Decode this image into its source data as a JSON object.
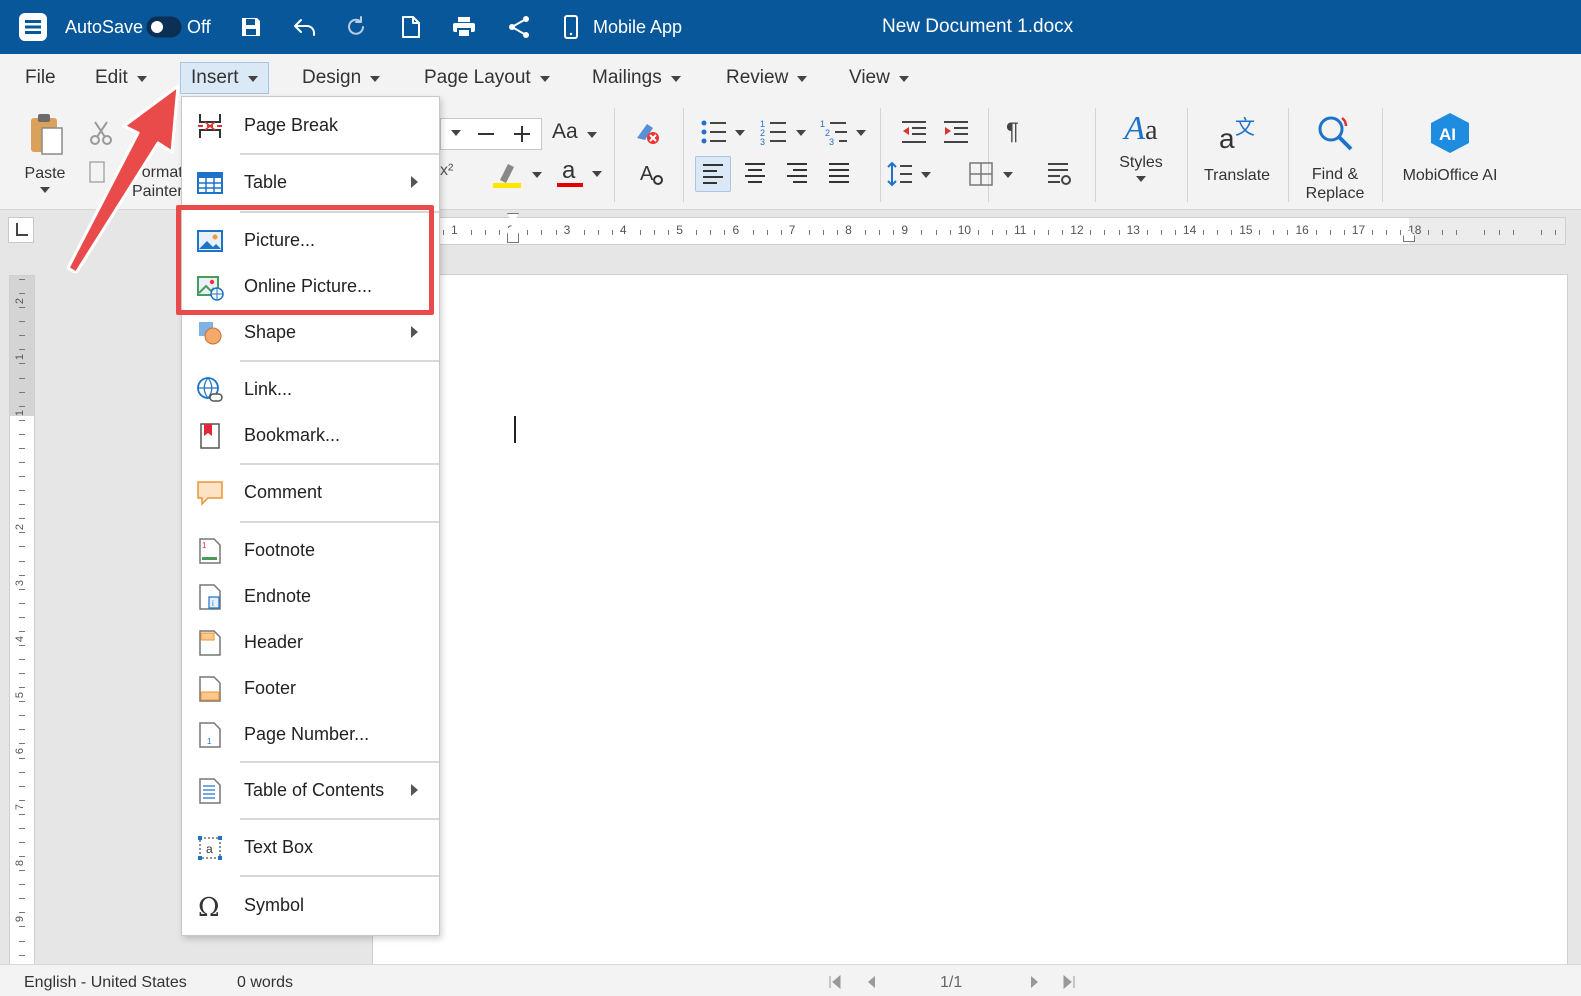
{
  "titlebar": {
    "autosave_label": "AutoSave",
    "autosave_state": "Off",
    "mobile_app_label": "Mobile App",
    "document_title": "New Document 1.docx"
  },
  "menubar": {
    "items": [
      {
        "label": "File"
      },
      {
        "label": "Edit"
      },
      {
        "label": "Insert"
      },
      {
        "label": "Design"
      },
      {
        "label": "Page Layout"
      },
      {
        "label": "Mailings"
      },
      {
        "label": "Review"
      },
      {
        "label": "View"
      }
    ]
  },
  "ribbon": {
    "paste": "Paste",
    "format_painter_1": "Format",
    "format_painter_2": "Painter",
    "font_size_options": "Aa",
    "paragraph_mark": "¶",
    "styles": "Styles",
    "translate": "Translate",
    "find_replace_1": "Find &",
    "find_replace_2": "Replace",
    "mobioffice_ai": "MobiOffice AI",
    "ai_badge": "AI"
  },
  "ruler": {
    "ticks": [
      "1",
      "1",
      "2",
      "3",
      "4",
      "5",
      "6",
      "7",
      "8",
      "9",
      "10",
      "11",
      "12",
      "13",
      "14",
      "15",
      "16",
      "17",
      "18"
    ]
  },
  "vruler": {
    "ticks": [
      "2",
      "1",
      "1",
      "2",
      "3",
      "4",
      "5",
      "6",
      "7",
      "8",
      "9"
    ]
  },
  "insert_menu": {
    "items": [
      {
        "label": "Page Break"
      },
      {
        "label": "Table"
      },
      {
        "label": "Picture..."
      },
      {
        "label": "Online Picture..."
      },
      {
        "label": "Shape"
      },
      {
        "label": "Link..."
      },
      {
        "label": "Bookmark..."
      },
      {
        "label": "Comment"
      },
      {
        "label": "Footnote"
      },
      {
        "label": "Endnote"
      },
      {
        "label": "Header"
      },
      {
        "label": "Footer"
      },
      {
        "label": "Page Number..."
      },
      {
        "label": "Table of Contents"
      },
      {
        "label": "Text Box"
      },
      {
        "label": "Symbol"
      }
    ]
  },
  "statusbar": {
    "language": "English - United States",
    "words": "0 words",
    "page": "1/1"
  },
  "colors": {
    "titlebar": "#07579a",
    "highlight": "#e94b4b",
    "accent": "#1e73c8"
  }
}
